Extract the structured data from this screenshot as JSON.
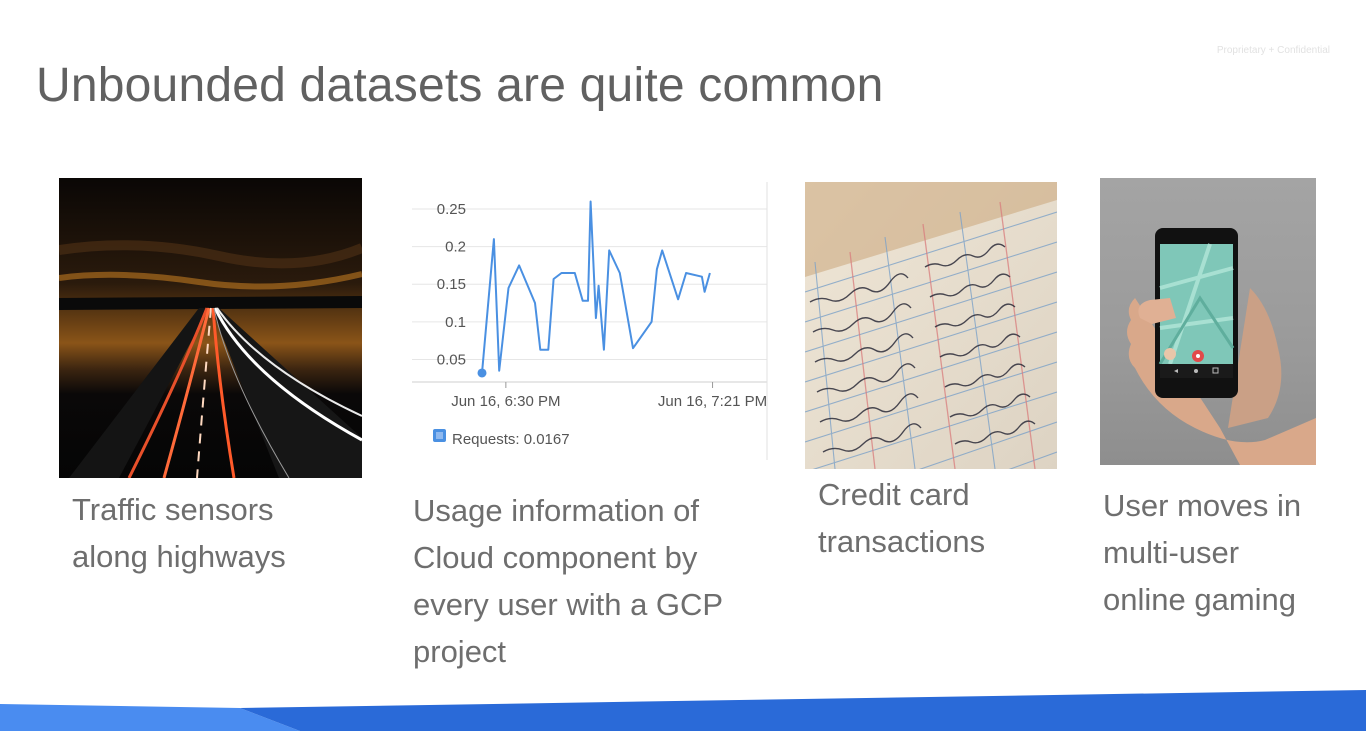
{
  "slide": {
    "title": "Unbounded datasets are quite common",
    "confidential": "Proprietary + Confidential"
  },
  "cards": [
    {
      "lines": [
        "Traffic sensors",
        "along highways"
      ]
    },
    {
      "lines": [
        "Usage information of",
        "Cloud component by",
        "every user with a GCP",
        "project"
      ]
    },
    {
      "lines": [
        "Credit card",
        "transactions"
      ]
    },
    {
      "lines": [
        "User moves in",
        "multi-user",
        "online gaming"
      ]
    }
  ],
  "colors": {
    "title": "#616161",
    "caption": "#6e6e6e",
    "line": "#4a90e2",
    "grid": "#e6e6e6",
    "bottom_bar": "#3a7de0"
  },
  "chart_data": {
    "type": "line",
    "yticks": [
      "0.25",
      "0.2",
      "0.15",
      "0.1",
      "0.05"
    ],
    "ytick_values": [
      0.25,
      0.2,
      0.15,
      0.1,
      0.05
    ],
    "ylim": [
      0.02,
      0.27
    ],
    "xticks": [
      "Jun 16, 6:30 PM",
      "Jun 16, 7:21 PM"
    ],
    "xtick_values": [
      0.09,
      0.87
    ],
    "legend": {
      "label": "Requests: 0.0167"
    },
    "series": [
      {
        "x": [
          0.0,
          0.045,
          0.065,
          0.1,
          0.14,
          0.2,
          0.22,
          0.25,
          0.27,
          0.3,
          0.35,
          0.38,
          0.4,
          0.41,
          0.43,
          0.44,
          0.46,
          0.48,
          0.52,
          0.57,
          0.64,
          0.66,
          0.68,
          0.74,
          0.77,
          0.83,
          0.84,
          0.86
        ],
        "y": [
          0.032,
          0.21,
          0.035,
          0.145,
          0.175,
          0.125,
          0.063,
          0.063,
          0.157,
          0.165,
          0.165,
          0.128,
          0.128,
          0.26,
          0.105,
          0.148,
          0.063,
          0.195,
          0.165,
          0.065,
          0.1,
          0.17,
          0.195,
          0.13,
          0.165,
          0.16,
          0.14,
          0.165
        ]
      }
    ]
  }
}
